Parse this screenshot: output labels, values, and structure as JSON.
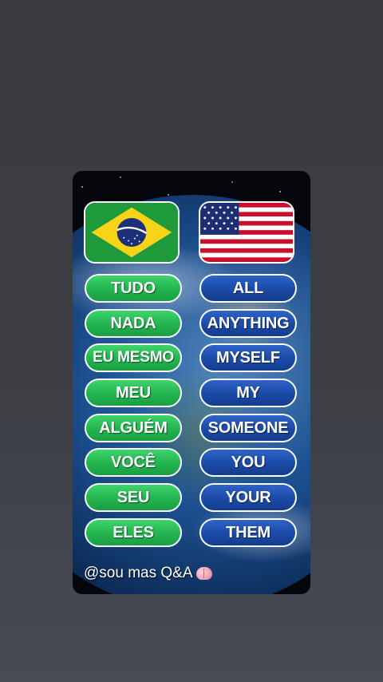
{
  "flags": {
    "left": {
      "icon": "brazil-flag-icon"
    },
    "right": {
      "icon": "usa-flag-icon"
    }
  },
  "colors": {
    "pt_pill": "#22b44f",
    "en_pill": "#1b4aa6",
    "pill_border": "#ffffff"
  },
  "words": {
    "pt": [
      "TUDO",
      "NADA",
      "EU MESMO",
      "MEU",
      "ALGUÉM",
      "VOCÊ",
      "SEU",
      "ELES"
    ],
    "en": [
      "ALL",
      "ANYTHING",
      "MYSELF",
      "MY",
      "SOMEONE",
      "YOU",
      "YOUR",
      "THEM"
    ]
  },
  "watermark": {
    "text": "@sou mas Q&A",
    "icon": "brain-icon"
  }
}
